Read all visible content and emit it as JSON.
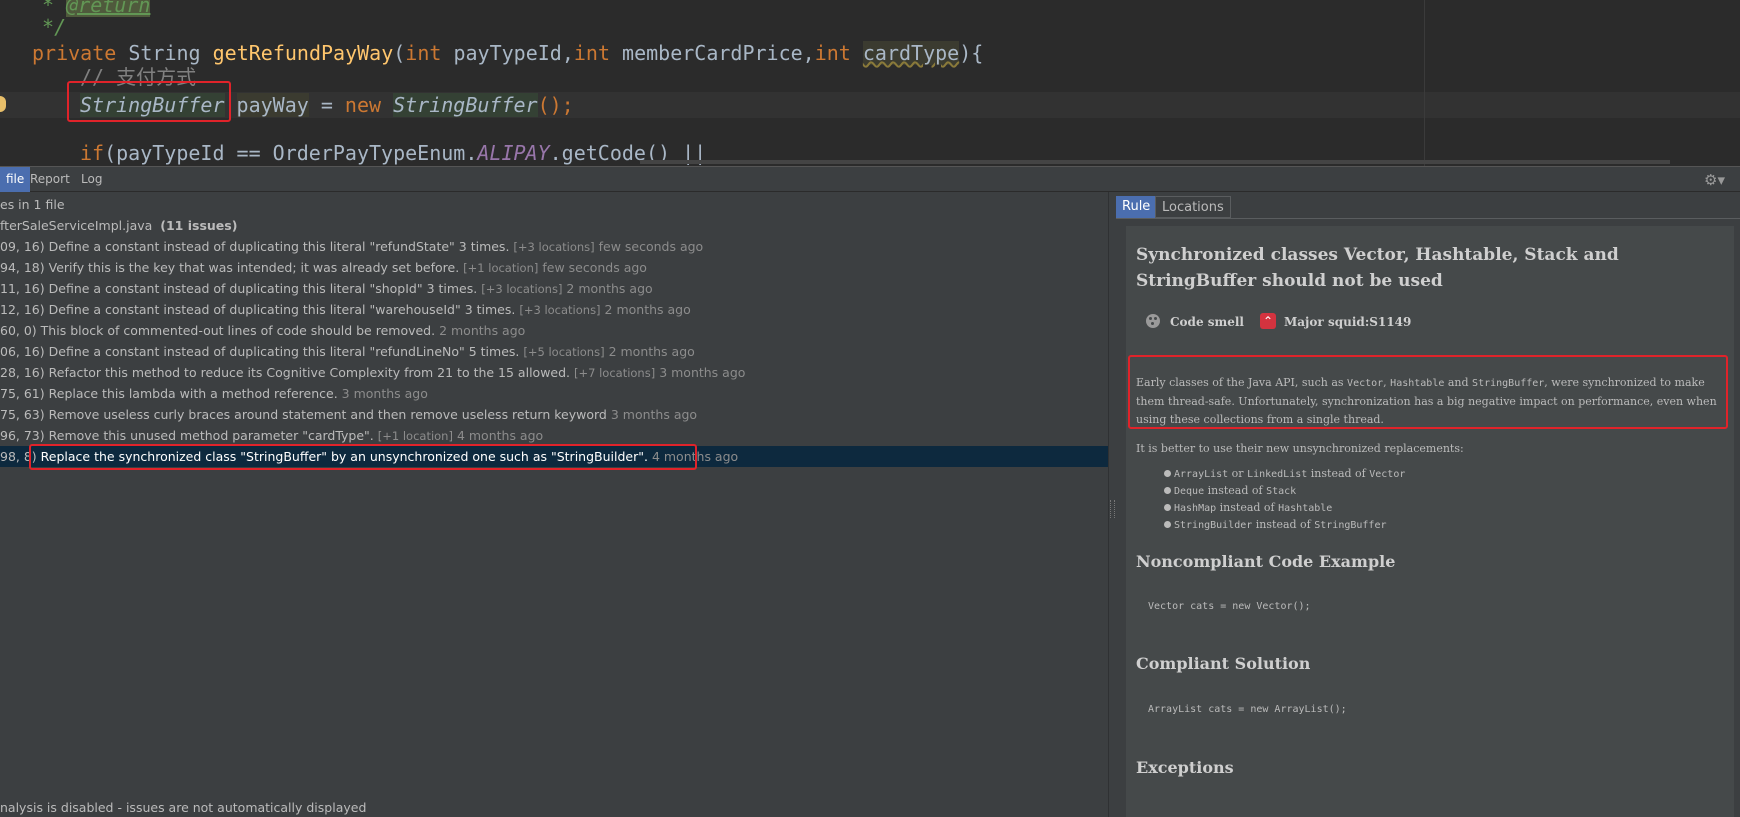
{
  "editor": {
    "line1": {
      "prefix": " * ",
      "tag": "@return"
    },
    "line2": " */",
    "line3": {
      "kw_private": "private",
      "type": " String ",
      "method": "getRefundPayWay",
      "open": "(",
      "kw_int1": "int",
      "p1": " payTypeId,",
      "kw_int2": "int",
      "p2": " memberCardPrice,",
      "kw_int3": "int",
      "p3_sep": " ",
      "p3": "cardType",
      "close": "){"
    },
    "line4": "// 支付方式",
    "line5": {
      "cls1": "StringBuffer",
      "sp": " ",
      "var": "payWay",
      "eq": " = ",
      "kw_new": "new",
      "sp2": " ",
      "cls2": "StringBuffer",
      "end": "();"
    },
    "line6": {
      "kw_if": "if",
      "a": "(payTypeId == OrderPayTypeEnum.",
      "field": "ALIPAY",
      "b": ".getCode() ||"
    }
  },
  "tool_tabs": {
    "tabs": [
      "file",
      "Report",
      "Log"
    ],
    "gear": "⚙▾"
  },
  "issues_panel": {
    "summary": "es in 1 file",
    "file_name": "fterSaleServiceImpl.java",
    "file_count": "(11 issues)",
    "items": [
      {
        "coord": "09, 16)",
        "message": "Define a constant instead of duplicating this literal \"refundState\" 3 times.",
        "locations": "[+3 locations]",
        "age": "few seconds ago"
      },
      {
        "coord": "94, 18)",
        "message": "Verify this is the key that was intended; it was already set before.",
        "locations": "[+1 location]",
        "age": "few seconds ago"
      },
      {
        "coord": "11, 16)",
        "message": "Define a constant instead of duplicating this literal \"shopId\" 3 times.",
        "locations": "[+3 locations]",
        "age": "2 months ago"
      },
      {
        "coord": "12, 16)",
        "message": "Define a constant instead of duplicating this literal \"warehouseId\" 3 times.",
        "locations": "[+3 locations]",
        "age": "2 months ago"
      },
      {
        "coord": "60, 0)",
        "message": "This block of commented-out lines of code should be removed.",
        "locations": "",
        "age": "2 months ago"
      },
      {
        "coord": "06, 16)",
        "message": "Define a constant instead of duplicating this literal \"refundLineNo\" 5 times.",
        "locations": "[+5 locations]",
        "age": "2 months ago"
      },
      {
        "coord": "28, 16)",
        "message": "Refactor this method to reduce its Cognitive Complexity from 21 to the 15 allowed.",
        "locations": "[+7 locations]",
        "age": "3 months ago"
      },
      {
        "coord": "75, 61)",
        "message": "Replace this lambda with a method reference.",
        "locations": "",
        "age": "3 months ago"
      },
      {
        "coord": "75, 63)",
        "message": "Remove useless curly braces around statement and then remove useless return keyword",
        "locations": "",
        "age": "3 months ago"
      },
      {
        "coord": "96, 73)",
        "message": "Remove this unused method parameter \"cardType\".",
        "locations": "[+1 location]",
        "age": "4 months ago"
      },
      {
        "coord": "98, 8)",
        "message": "Replace the synchronized class \"StringBuffer\" by an unsynchronized one such as \"StringBuilder\".",
        "locations": "",
        "age": "4 months ago",
        "selected": true
      }
    ],
    "status": "nalysis is disabled - issues are not automatically displayed"
  },
  "rule_panel": {
    "tabs": [
      "Rule",
      "Locations"
    ],
    "title": "Synchronized classes Vector, Hashtable, Stack and StringBuffer should not be used",
    "type": "Code smell",
    "severity": "Major",
    "key": "squid:S1149",
    "para1": {
      "a": "Early classes of the Java API, such as ",
      "c1": "Vector",
      "b": ", ",
      "c2": "Hashtable",
      "c": " and ",
      "c3": "StringBuffer",
      "d": ", were synchronized to make them thread-safe. Unfortunately, synchronization has a big negative impact on performance, even when using these collections from a single thread."
    },
    "para2": "It is better to use their new unsynchronized replacements:",
    "bullets": [
      {
        "new": "ArrayList",
        "or": " or ",
        "alt": "LinkedList",
        "mid": " instead of ",
        "old": "Vector"
      },
      {
        "new": "Deque",
        "or": "",
        "alt": "",
        "mid": " instead of ",
        "old": "Stack"
      },
      {
        "new": "HashMap",
        "or": "",
        "alt": "",
        "mid": " instead of ",
        "old": "Hashtable"
      },
      {
        "new": "StringBuilder",
        "or": "",
        "alt": "",
        "mid": " instead of ",
        "old": "StringBuffer"
      }
    ],
    "noncompliant_heading": "Noncompliant Code Example",
    "noncompliant_code": "Vector cats = new Vector();",
    "compliant_heading": "Compliant Solution",
    "compliant_code": "ArrayList cats = new ArrayList();",
    "exceptions_heading": "Exceptions"
  },
  "colors": {
    "highlight_box": "#e0232a",
    "selection": "#0d293e",
    "tab_active": "#4b6eaf",
    "major": "#d4333f"
  }
}
